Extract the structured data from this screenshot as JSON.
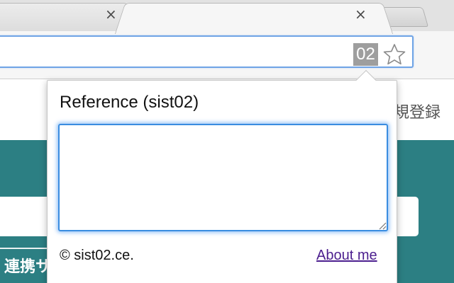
{
  "browser": {
    "tabs": [
      {
        "close_symbol": "×"
      },
      {
        "close_symbol": "×"
      }
    ],
    "extension_badge": "02",
    "icons": {
      "extension": "extension-badge-icon",
      "bookmark": "star-icon",
      "close": "close-icon",
      "new_tab": "new-tab-icon"
    },
    "colors": {
      "omnibox_focus": "#6fa4e6",
      "extension_badge": "#9e9e9e"
    }
  },
  "page": {
    "register_label": "規登録",
    "button_label": "連携サ",
    "colors": {
      "banner": "#2c7f83"
    }
  },
  "popup": {
    "title": "Reference (sist02)",
    "textarea_value": "",
    "copyright": "© sist02.ce.",
    "about_link": "About me",
    "colors": {
      "focus_ring": "#3a8de0",
      "link": "#4b1e8e"
    }
  }
}
